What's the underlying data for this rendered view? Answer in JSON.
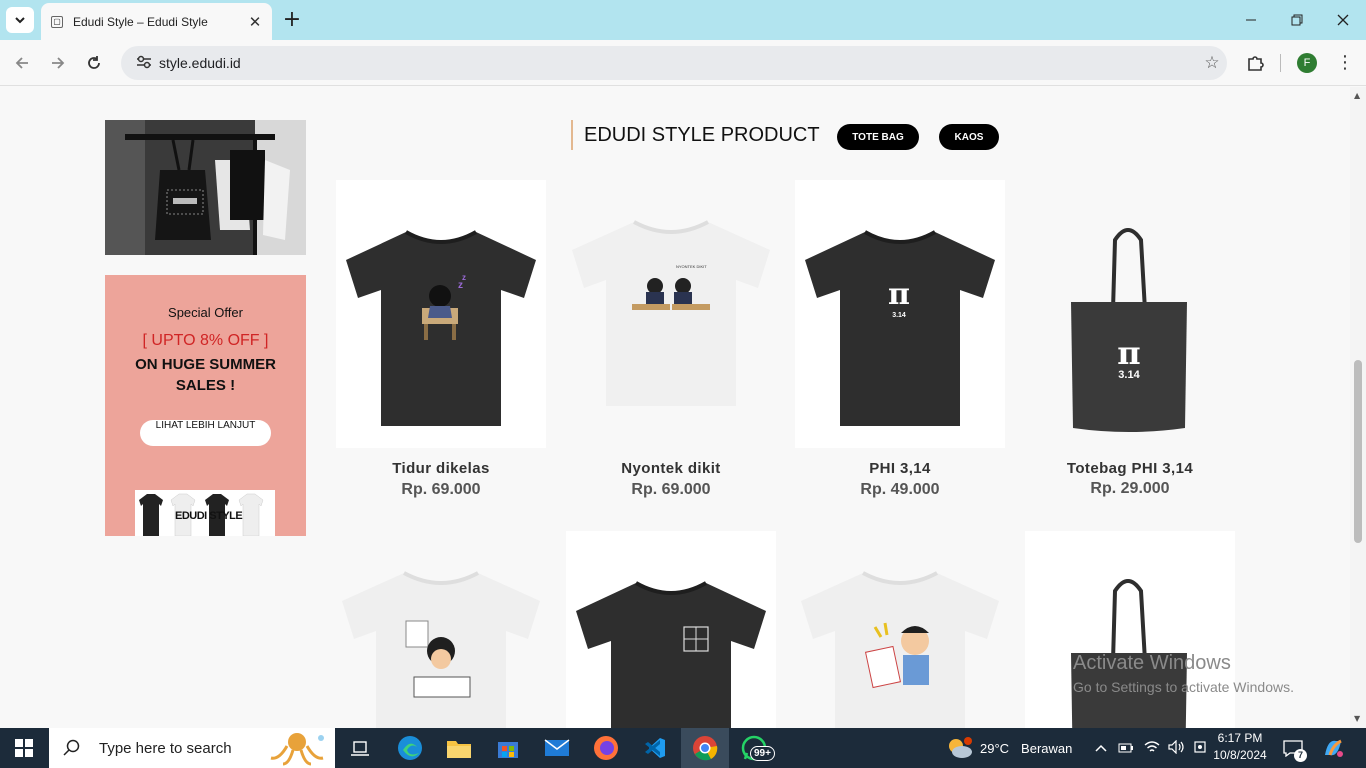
{
  "browser": {
    "tab_title": "Edudi Style – Edudi Style",
    "url": "style.edudi.id",
    "profile_initial": "F"
  },
  "promo": {
    "special_offer": "Special Offer",
    "discount": "[ UPTO 8% OFF ]",
    "sale_text": "ON HUGE SUMMER SALES !",
    "cta": "LIHAT LEBIH LANJUT",
    "mini_banner": "EDUDI STYLE"
  },
  "section": {
    "title": "EDUDI STYLE PRODUCT",
    "filters": [
      "TOTE BAG",
      "KAOS"
    ]
  },
  "products": [
    {
      "name": "Tidur dikelas",
      "price": "Rp. 69.000"
    },
    {
      "name": "Nyontek dikit",
      "price": "Rp. 69.000"
    },
    {
      "name": "PHI 3,14",
      "price": "Rp. 49.000"
    },
    {
      "name": "Totebag PHI 3,14",
      "price": "Rp. 29.000"
    }
  ],
  "product_art": {
    "pi_symbol": "π",
    "pi_value": "3.14"
  },
  "watermark": {
    "line1": "Activate Windows",
    "line2": "Go to Settings to activate Windows."
  },
  "taskbar": {
    "search_placeholder": "Type here to search",
    "whatsapp_badge": "99+",
    "temperature": "29°C",
    "weather": "Berawan",
    "time": "6:17 PM",
    "date": "10/8/2024",
    "notification_count": "7"
  },
  "colors": {
    "titlebar": "#b2e4ef",
    "promo_bg": "#eda49a",
    "discount_red": "#d02525",
    "taskbar": "#1c2b3a"
  }
}
